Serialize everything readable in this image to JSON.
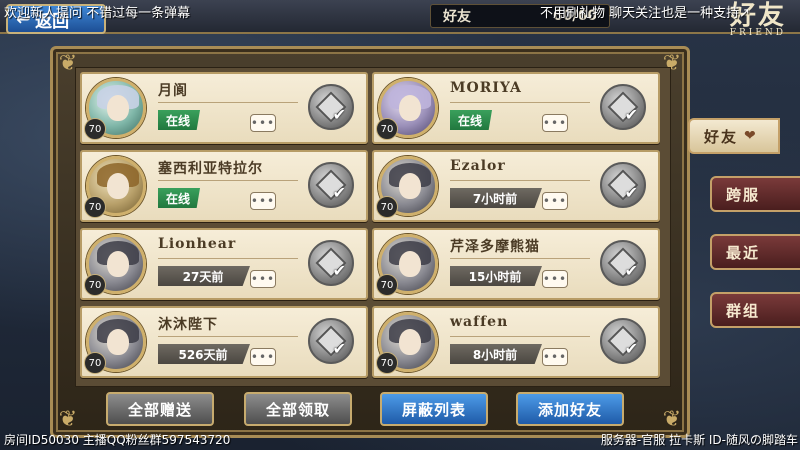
{
  "header": {
    "back_label": "返回",
    "title": "好友",
    "count": "60/60",
    "logo_cn": "好友",
    "logo_en": "FRIEND"
  },
  "overlays": {
    "top_left": "欢迎新人提问 不错过每一条弹幕",
    "top_right": "不用刷礼物 聊天关注也是一种支持↗",
    "bottom_left": "房间ID50030 主播QQ粉丝群597543720",
    "bottom_right": "服务器-官服 拉卡斯 ID-随风の脚踏车"
  },
  "friends": [
    {
      "name": "月阆",
      "status": "在线",
      "status_type": "online",
      "level": "70"
    },
    {
      "name": "MORIYA",
      "status": "在线",
      "status_type": "online",
      "level": "70"
    },
    {
      "name": "塞西利亚特拉尔",
      "status": "在线",
      "status_type": "online",
      "level": "70"
    },
    {
      "name": "Ezalor",
      "status": "7小时前",
      "status_type": "offline",
      "level": "70"
    },
    {
      "name": "Lionhear",
      "status": "27天前",
      "status_type": "offline",
      "level": "70"
    },
    {
      "name": "芹泽多摩熊猫",
      "status": "15小时前",
      "status_type": "offline",
      "level": "70"
    },
    {
      "name": "沐沐陛下",
      "status": "526天前",
      "status_type": "offline",
      "level": "70"
    },
    {
      "name": "waffen",
      "status": "8小时前",
      "status_type": "offline",
      "level": "70"
    }
  ],
  "chat_glyph": "•••",
  "check_glyph": "✔",
  "bottom_buttons": {
    "send_all": "全部赠送",
    "receive_all": "全部领取",
    "block_list": "屏蔽列表",
    "add_friend": "添加好友"
  },
  "side_tabs": {
    "friends": "好友",
    "cross_server": "跨服",
    "recent": "最近",
    "group": "群组"
  }
}
